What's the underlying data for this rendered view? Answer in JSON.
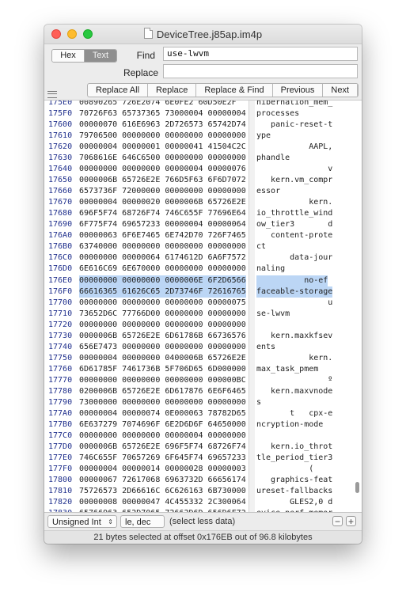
{
  "window": {
    "title": "DeviceTree.j85ap.im4p"
  },
  "find_bar": {
    "mode_hex": "Hex",
    "mode_text": "Text",
    "find_label": "Find",
    "find_value": "use-lwvm",
    "replace_label": "Replace",
    "replace_value": ""
  },
  "buttons": [
    "Replace All",
    "Replace",
    "Replace & Find",
    "Previous",
    "Next"
  ],
  "rows": [
    {
      "off": "175E0",
      "hex": "00890265 726E2074 6E0FE2 60D50E2F",
      "txt": "hibernation_mem_"
    },
    {
      "off": "175F0",
      "hex": "70726F63 65737365 73000004 00000004",
      "txt": "processes"
    },
    {
      "off": "17600",
      "hex": "00000070 616E6963 2D726573 65742D74",
      "txt": "   panic-reset-t"
    },
    {
      "off": "17610",
      "hex": "79706500 00000000 00000000 00000000",
      "txt": "ype"
    },
    {
      "off": "17620",
      "hex": "00000004 00000001 00000041 41504C2C",
      "txt": "           AAPL,"
    },
    {
      "off": "17630",
      "hex": "7068616E 646C6500 00000000 00000000",
      "txt": "phandle"
    },
    {
      "off": "17640",
      "hex": "00000000 00000000 00000004 00000076",
      "txt": "               v"
    },
    {
      "off": "17650",
      "hex": "0000006B 65726E2E 766D5F63 6F6D7072",
      "txt": "   kern.vm_compr"
    },
    {
      "off": "17660",
      "hex": "6573736F 72000000 00000000 00000000",
      "txt": "essor"
    },
    {
      "off": "17670",
      "hex": "00000004 00000020 0000006B 65726E2E",
      "txt": "           kern."
    },
    {
      "off": "17680",
      "hex": "696F5F74 68726F74 746C655F 77696E64",
      "txt": "io_throttle_wind"
    },
    {
      "off": "17690",
      "hex": "6F775F74 69657233 00000004 00000064",
      "txt": "ow_tier3       d"
    },
    {
      "off": "176A0",
      "hex": "00000063 6F6E7465 6E742D70 726F7465",
      "txt": "   content-prote"
    },
    {
      "off": "176B0",
      "hex": "63740000 00000000 00000000 00000000",
      "txt": "ct"
    },
    {
      "off": "176C0",
      "hex": "00000000 00000064 6174612D 6A6F7572",
      "txt": "       data-jour"
    },
    {
      "off": "176D0",
      "hex": "6E616C69 6E670000 00000000 00000000",
      "txt": "naling"
    },
    {
      "off": "176E0",
      "hex": "00000000 00000000 0000006E 6F2D6566",
      "txt": "          no-ef",
      "sel": true
    },
    {
      "off": "176F0",
      "hex": "66616365 61626C65 2D73746F 72616765",
      "txt": "faceable-storage",
      "sel": true
    },
    {
      "off": "17700",
      "hex": "00000000 00000000 00000000 00000075",
      "txt": "               u"
    },
    {
      "off": "17710",
      "hex": "73652D6C 77766D00 00000000 00000000",
      "txt": "se-lwvm"
    },
    {
      "off": "17720",
      "hex": "00000000 00000000 00000000 00000000",
      "txt": ""
    },
    {
      "off": "17730",
      "hex": "0000006B 65726E2E 6D61786B 66736576",
      "txt": "   kern.maxkfsev"
    },
    {
      "off": "17740",
      "hex": "656E7473 00000000 00000000 00000000",
      "txt": "ents"
    },
    {
      "off": "17750",
      "hex": "00000004 00000000 0400006B 65726E2E",
      "txt": "           kern."
    },
    {
      "off": "17760",
      "hex": "6D61785F 7461736B 5F706D65 6D000000",
      "txt": "max_task_pmem"
    },
    {
      "off": "17770",
      "hex": "00000000 00000000 00000000 000000BC",
      "txt": "               º"
    },
    {
      "off": "17780",
      "hex": "0200006B 65726E2E 6D617876 6E6F6465",
      "txt": "   kern.maxvnode"
    },
    {
      "off": "17790",
      "hex": "73000000 00000000 00000000 00000000",
      "txt": "s"
    },
    {
      "off": "177A0",
      "hex": "00000004 00000074 0E000063 78782D65",
      "txt": "       t   cpx-e"
    },
    {
      "off": "177B0",
      "hex": "6E637279 7074696F 6E2D6D6F 64650000",
      "txt": "ncryption-mode"
    },
    {
      "off": "177C0",
      "hex": "00000000 00000000 00000004 00000000",
      "txt": ""
    },
    {
      "off": "177D0",
      "hex": "0000006B 65726E2E 696F5F74 68726F74",
      "txt": "   kern.io_throt"
    },
    {
      "off": "177E0",
      "hex": "746C655F 70657269 6F645F74 69657233",
      "txt": "tle_period_tier3"
    },
    {
      "off": "177F0",
      "hex": "00000004 00000014 00000028 00000003",
      "txt": "           ("
    },
    {
      "off": "17800",
      "hex": "00000067 72617068 6963732D 66656174",
      "txt": "   graphics-feat"
    },
    {
      "off": "17810",
      "hex": "75726573 2D66616C 6C626163 6B730000",
      "txt": "ureset-fallbacks"
    },
    {
      "off": "17820",
      "hex": "00000008 00000047 4C455332 2C300064",
      "txt": "       GLES2,0 d"
    },
    {
      "off": "17830",
      "hex": "65766963 652D7065 72662D6D 656D6F72",
      "txt": "evice-perf-memor"
    }
  ],
  "bottom_bar": {
    "type_label": "Unsigned Int",
    "endian_label": "le, dec",
    "selection_hint": "(select less data)",
    "minus": "−",
    "plus": "+"
  },
  "status": "21 bytes selected at offset 0x176EB out of 96.8 kilobytes",
  "colors": {
    "offset_text": "#1f2f8c",
    "selection": "#bcd6f5",
    "close": "#ff5f57",
    "minimize": "#febc2e",
    "zoom": "#28c840"
  }
}
